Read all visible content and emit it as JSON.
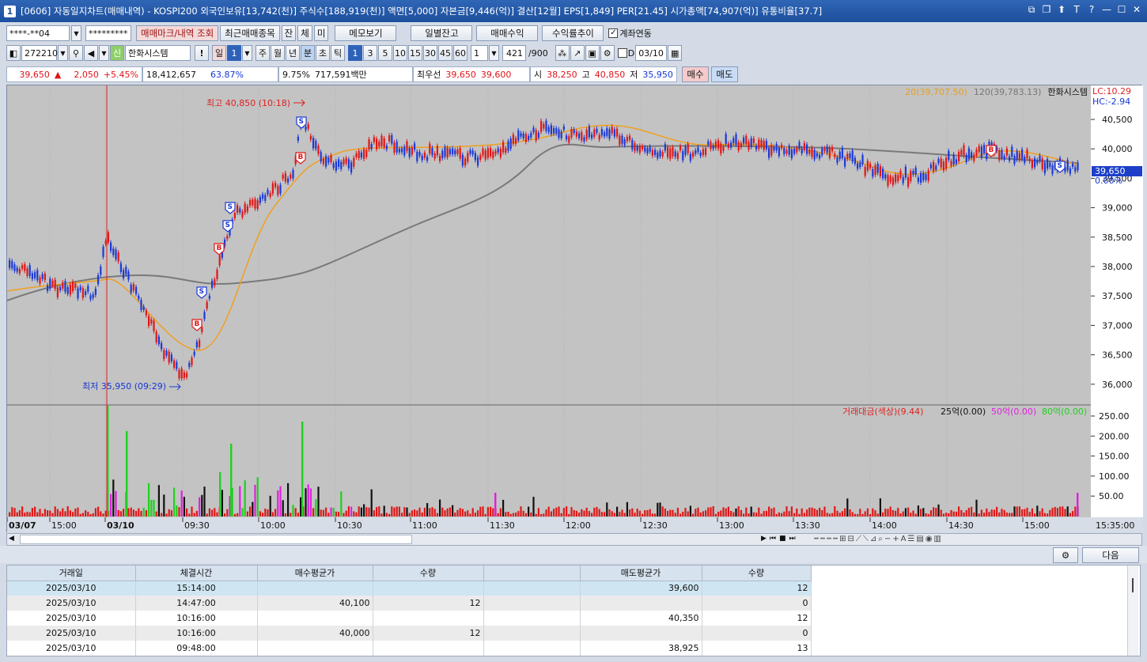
{
  "window": {
    "title": "[0606] 자동일지차트(매매내역) - KOSPI200 외국인보유[13,742(천)] 주식수[188,919(천)] 액면[5,000] 자본금[9,446(억)] 결산[12월] EPS[1,849] PER[21.45] 시가총액[74,907(억)] 유통비율[37.7]",
    "icon": "1",
    "controls": [
      "restore-icon",
      "copy-icon",
      "pin-icon",
      "text-icon",
      "help-icon",
      "minimize-icon",
      "maximize-icon",
      "close-icon"
    ]
  },
  "toolbar1": {
    "account": "****-**04",
    "password": "*********",
    "btn_mark": "매매마크/내역 조회",
    "btn_recent": "최근매매종목",
    "tab_jan": "잔",
    "tab_che": "체",
    "tab_mi": "미",
    "btn_memo": "메모보기",
    "btn_daily": "일별잔고",
    "btn_trade": "매매수익",
    "btn_yield": "수익률추이",
    "link_label": "계좌연동",
    "link_checked": true
  },
  "toolbar2": {
    "code": "272210",
    "stock_name": "한화시스템",
    "period": "일",
    "period_num": "1",
    "btns": [
      "주",
      "월",
      "년",
      "분",
      "초",
      "틱"
    ],
    "selected": "분",
    "minutes": [
      "1",
      "3",
      "5",
      "10",
      "15",
      "30",
      "45",
      "60"
    ],
    "selected_min": "1",
    "count": "1",
    "bars": "421",
    "bars_max": "/900",
    "date_check_label": "D",
    "date": "03/10"
  },
  "quote": {
    "price": "39,650",
    "arrow": "▲",
    "change": "2,050",
    "pct": "+5.45%",
    "volume": "18,412,657",
    "vol_rate": "63.87%",
    "turnover": "9.75%",
    "amount": "717,591백만",
    "best_label": "최우선",
    "ask": "39,650",
    "bid": "39,600",
    "open_label": "시",
    "open": "38,250",
    "high_label": "고",
    "high": "40,850",
    "low_label": "저",
    "low": "35,950",
    "buy": "매수",
    "sell": "매도"
  },
  "chart": {
    "legend": {
      "ma20": "20(39,707.50)",
      "ma120": "120(39,783.13)",
      "name": "한화시스템"
    },
    "lc": "LC:10.29",
    "hc": "HC:-2.94",
    "current_price": "39,650",
    "current_pct": "0.00%",
    "high_label": "최고 40,850 (10:18)",
    "low_label": "최저 35,950 (09:29)",
    "price_axis": [
      "40,500",
      "40,000",
      "39,500",
      "39,000",
      "38,500",
      "38,000",
      "37,500",
      "37,000",
      "36,500",
      "36,000"
    ],
    "vol_legend": {
      "label": "거래대금(색상)(9.44)",
      "v25": "25억(0.00)",
      "v50": "50억(0.00)",
      "v80": "80억(0.00)"
    },
    "vol_axis": [
      "250.00",
      "200.00",
      "150.00",
      "100.00",
      "50.00"
    ],
    "time_axis": [
      "03/07",
      "15:00",
      "03/10",
      "09:30",
      "10:00",
      "10:30",
      "11:00",
      "11:30",
      "12:00",
      "12:30",
      "13:00",
      "13:30",
      "14:00",
      "14:30",
      "15:00"
    ],
    "time_end": "15:35:00",
    "marks": [
      "B",
      "S",
      "B",
      "S",
      "S",
      "B",
      "S",
      "B",
      "S"
    ]
  },
  "next_button": "다음",
  "table": {
    "headers": [
      "거래일",
      "체결시간",
      "매수평균가",
      "수량",
      "",
      "매도평균가",
      "수량"
    ],
    "rows": [
      [
        "2025/03/10",
        "15:14:00",
        "",
        "",
        "",
        "39,600",
        "12"
      ],
      [
        "2025/03/10",
        "14:47:00",
        "40,100",
        "12",
        "",
        "",
        "0"
      ],
      [
        "2025/03/10",
        "10:16:00",
        "",
        "",
        "",
        "40,350",
        "12"
      ],
      [
        "2025/03/10",
        "10:16:00",
        "40,000",
        "12",
        "",
        "",
        "0"
      ],
      [
        "2025/03/10",
        "09:48:00",
        "",
        "",
        "",
        "38,925",
        "13"
      ]
    ]
  }
}
